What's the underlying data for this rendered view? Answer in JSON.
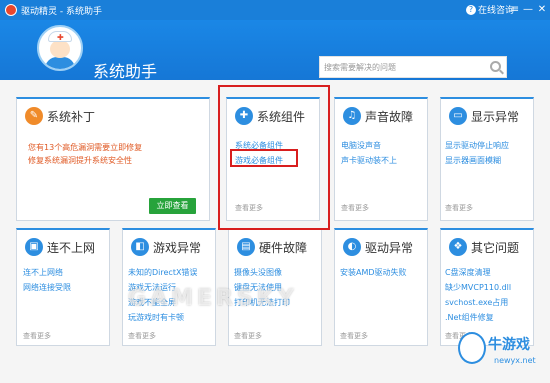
{
  "window": {
    "title": "驱动精灵 - 系统助手",
    "help_label": "在线咨询",
    "help_icon": "?",
    "menu_icon": "≡",
    "minimize_icon": "—",
    "close_icon": "✕"
  },
  "header": {
    "title": "系统助手",
    "search_placeholder": "搜索需要解决的问题"
  },
  "cards": {
    "patch": {
      "title": "系统补丁",
      "desc_prefix": "您有",
      "desc_count": "13",
      "desc_suffix": "个高危漏洞需要立即修复",
      "desc_line2": "修复系统漏洞提升系统安全性",
      "button": "立即查看",
      "icon": "✎"
    },
    "component": {
      "title": "系统组件",
      "links": [
        "系统必备组件",
        "游戏必备组件"
      ],
      "more": "查看更多",
      "icon": "✚"
    },
    "sound": {
      "title": "声音故障",
      "links": [
        "电脑没声音",
        "声卡驱动装不上"
      ],
      "more": "查看更多",
      "icon": "♫"
    },
    "display": {
      "title": "显示异常",
      "links": [
        "显示驱动停止响应",
        "显示器画面模糊"
      ],
      "more": "查看更多",
      "icon": "▭"
    },
    "network": {
      "title": "连不上网",
      "links": [
        "连不上网络",
        "网络连接受限"
      ],
      "more": "查看更多",
      "icon": "▣"
    },
    "game": {
      "title": "游戏异常",
      "links": [
        "未知的DirectX错误",
        "游戏无法运行",
        "游戏不能全屏",
        "玩游戏时有卡顿"
      ],
      "more": "查看更多",
      "icon": "◧"
    },
    "hardware": {
      "title": "硬件故障",
      "links": [
        "摄像头没图像",
        "键盘无法使用",
        "打印机无法打印"
      ],
      "more": "查看更多",
      "icon": "▤"
    },
    "driver": {
      "title": "驱动异常",
      "links": [
        "安装AMD驱动失败"
      ],
      "more": "查看更多",
      "icon": "◐"
    },
    "other": {
      "title": "其它问题",
      "links": [
        "C盘深度清理",
        "缺少MVCP110.dll",
        "svchost.exe占用",
        ".Net组件修复"
      ],
      "more": "查看更多",
      "icon": "❖"
    }
  },
  "watermark": "GAMERSKY",
  "logo": {
    "text": "牛游戏",
    "url": "newyx.net"
  },
  "colors": {
    "accent": "#2d8ee0",
    "highlight": "#d81e1e",
    "button": "#27a33b"
  }
}
